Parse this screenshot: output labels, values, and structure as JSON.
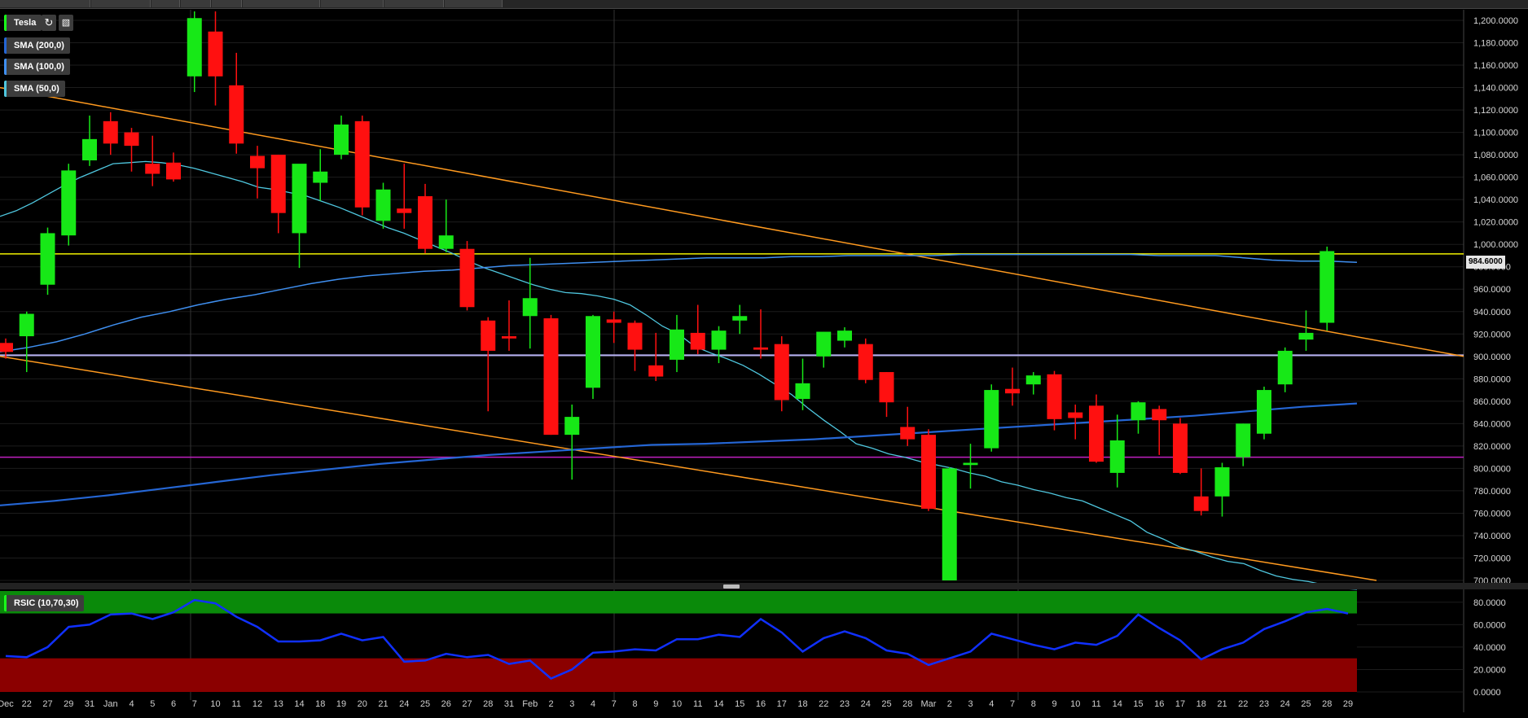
{
  "legend": {
    "symbol": "Tesla",
    "sma200": "SMA (200,0)",
    "sma100": "SMA (100,0)",
    "sma50": "SMA (50,0)",
    "rsi": "RSIC (10,70,30)"
  },
  "icons": {
    "refresh": "refresh-icon",
    "chart_type": "chart-type-icon"
  },
  "colors": {
    "up": "#17e817",
    "down": "#ff1010",
    "sma200": "#2566d4",
    "sma100": "#3f8ff0",
    "sma50": "#4fc7df",
    "trend": "#ff9a1f",
    "yellow": "#f0f000",
    "lavender": "#b9b3f5",
    "magenta": "#c020c0",
    "rsi_line": "#1030ff"
  },
  "last_price": "984.6000",
  "chart_data": [
    {
      "type": "candlestick",
      "title": "Tesla",
      "ylim": [
        700,
        1200
      ],
      "y_ticks": [
        "1,200.0000",
        "1,180.0000",
        "1,160.0000",
        "1,140.0000",
        "1,120.0000",
        "1,100.0000",
        "1,080.0000",
        "1,060.0000",
        "1,040.0000",
        "1,020.0000",
        "1,000.0000",
        "980.0000",
        "960.0000",
        "940.0000",
        "920.0000",
        "900.0000",
        "880.0000",
        "860.0000",
        "840.0000",
        "820.0000",
        "800.0000",
        "780.0000",
        "760.0000",
        "740.0000",
        "720.0000",
        "700.0000"
      ],
      "x_labels": [
        "Dec",
        "22",
        "27",
        "29",
        "31",
        "Jan",
        "4",
        "5",
        "6",
        "7",
        "10",
        "11",
        "12",
        "13",
        "14",
        "18",
        "19",
        "20",
        "21",
        "24",
        "25",
        "26",
        "27",
        "28",
        "31",
        "Feb",
        "2",
        "3",
        "4",
        "7",
        "8",
        "9",
        "10",
        "11",
        "14",
        "15",
        "16",
        "17",
        "18",
        "22",
        "23",
        "24",
        "25",
        "28",
        "Mar",
        "2",
        "3",
        "4",
        "7",
        "8",
        "9",
        "10",
        "11",
        "14",
        "15",
        "16",
        "17",
        "18",
        "21",
        "22",
        "23",
        "24",
        "25",
        "28",
        "29"
      ],
      "candles": [
        {
          "o": 912,
          "h": 916,
          "l": 898,
          "c": 904
        },
        {
          "o": 918,
          "h": 940,
          "l": 886,
          "c": 938
        },
        {
          "o": 964,
          "h": 1015,
          "l": 955,
          "c": 1010
        },
        {
          "o": 1008,
          "h": 1072,
          "l": 999,
          "c": 1066
        },
        {
          "o": 1075,
          "h": 1115,
          "l": 1070,
          "c": 1094
        },
        {
          "o": 1110,
          "h": 1118,
          "l": 1080,
          "c": 1090
        },
        {
          "o": 1100,
          "h": 1104,
          "l": 1065,
          "c": 1088
        },
        {
          "o": 1072,
          "h": 1097,
          "l": 1052,
          "c": 1063
        },
        {
          "o": 1073,
          "h": 1082,
          "l": 1056,
          "c": 1058
        },
        {
          "o": 1150,
          "h": 1208,
          "l": 1136,
          "c": 1202
        },
        {
          "o": 1190,
          "h": 1208,
          "l": 1124,
          "c": 1150
        },
        {
          "o": 1142,
          "h": 1171,
          "l": 1081,
          "c": 1090
        },
        {
          "o": 1079,
          "h": 1088,
          "l": 1041,
          "c": 1068
        },
        {
          "o": 1080,
          "h": 1080,
          "l": 1010,
          "c": 1028
        },
        {
          "o": 1010,
          "h": 1068,
          "l": 979,
          "c": 1072
        },
        {
          "o": 1055,
          "h": 1085,
          "l": 1039,
          "c": 1065
        },
        {
          "o": 1080,
          "h": 1115,
          "l": 1076,
          "c": 1107
        },
        {
          "o": 1110,
          "h": 1115,
          "l": 1026,
          "c": 1033
        },
        {
          "o": 1021,
          "h": 1055,
          "l": 1014,
          "c": 1049
        },
        {
          "o": 1032,
          "h": 1072,
          "l": 1014,
          "c": 1028
        },
        {
          "o": 1043,
          "h": 1054,
          "l": 992,
          "c": 996
        },
        {
          "o": 996,
          "h": 1040,
          "l": 993,
          "c": 1008
        },
        {
          "o": 996,
          "h": 1003,
          "l": 941,
          "c": 944
        },
        {
          "o": 932,
          "h": 935,
          "l": 851,
          "c": 905
        },
        {
          "o": 918,
          "h": 950,
          "l": 905,
          "c": 916
        },
        {
          "o": 936,
          "h": 988,
          "l": 907,
          "c": 952
        },
        {
          "o": 934,
          "h": 937,
          "l": 830,
          "c": 830
        },
        {
          "o": 830,
          "h": 857,
          "l": 790,
          "c": 846
        },
        {
          "o": 872,
          "h": 937,
          "l": 862,
          "c": 936
        },
        {
          "o": 933,
          "h": 940,
          "l": 912,
          "c": 930
        },
        {
          "o": 930,
          "h": 932,
          "l": 887,
          "c": 906
        },
        {
          "o": 892,
          "h": 921,
          "l": 878,
          "c": 882
        },
        {
          "o": 897,
          "h": 937,
          "l": 886,
          "c": 924
        },
        {
          "o": 921,
          "h": 946,
          "l": 902,
          "c": 906
        },
        {
          "o": 906,
          "h": 927,
          "l": 894,
          "c": 923
        },
        {
          "o": 932,
          "h": 946,
          "l": 920,
          "c": 936
        },
        {
          "o": 908,
          "h": 942,
          "l": 898,
          "c": 906
        },
        {
          "o": 911,
          "h": 918,
          "l": 851,
          "c": 861
        },
        {
          "o": 862,
          "h": 898,
          "l": 852,
          "c": 876
        },
        {
          "o": 900,
          "h": 922,
          "l": 890,
          "c": 922
        },
        {
          "o": 914,
          "h": 926,
          "l": 908,
          "c": 923
        },
        {
          "o": 911,
          "h": 916,
          "l": 876,
          "c": 879
        },
        {
          "o": 886,
          "h": 886,
          "l": 846,
          "c": 859
        },
        {
          "o": 837,
          "h": 855,
          "l": 820,
          "c": 826
        },
        {
          "o": 830,
          "h": 835,
          "l": 762,
          "c": 764
        },
        {
          "o": 700,
          "h": 801,
          "l": 700,
          "c": 800
        },
        {
          "o": 803,
          "h": 822,
          "l": 782,
          "c": 805
        },
        {
          "o": 818,
          "h": 875,
          "l": 815,
          "c": 870
        },
        {
          "o": 871,
          "h": 890,
          "l": 856,
          "c": 867
        },
        {
          "o": 875,
          "h": 886,
          "l": 866,
          "c": 883
        },
        {
          "o": 884,
          "h": 887,
          "l": 834,
          "c": 844
        },
        {
          "o": 850,
          "h": 857,
          "l": 826,
          "c": 845
        },
        {
          "o": 856,
          "h": 866,
          "l": 805,
          "c": 806
        },
        {
          "o": 796,
          "h": 848,
          "l": 783,
          "c": 825
        },
        {
          "o": 843,
          "h": 860,
          "l": 831,
          "c": 859
        },
        {
          "o": 853,
          "h": 856,
          "l": 812,
          "c": 843
        },
        {
          "o": 840,
          "h": 845,
          "l": 795,
          "c": 796
        },
        {
          "o": 775,
          "h": 800,
          "l": 758,
          "c": 762
        },
        {
          "o": 775,
          "h": 805,
          "l": 757,
          "c": 801
        },
        {
          "o": 810,
          "h": 840,
          "l": 802,
          "c": 840
        },
        {
          "o": 831,
          "h": 873,
          "l": 826,
          "c": 870
        },
        {
          "o": 875,
          "h": 908,
          "l": 868,
          "c": 905
        },
        {
          "o": 915,
          "h": 941,
          "l": 905,
          "c": 921
        },
        {
          "o": 930,
          "h": 998,
          "l": 923,
          "c": 994
        }
      ],
      "sma50": [
        1025,
        1030,
        1037,
        1045,
        1053,
        1060,
        1066,
        1072,
        1073,
        1074,
        1073,
        1071,
        1068,
        1064,
        1060,
        1056,
        1051,
        1049,
        1046,
        1043,
        1038,
        1033,
        1027,
        1021,
        1015,
        1010,
        1004,
        998,
        992,
        985,
        979,
        974,
        969,
        964,
        960,
        957,
        956,
        954,
        951,
        946,
        937,
        927,
        920,
        909,
        903,
        898,
        892,
        884,
        875,
        866,
        854,
        843,
        833,
        822,
        818,
        813,
        810,
        806,
        803,
        800,
        796,
        793,
        788,
        785,
        781,
        778,
        774,
        771,
        765,
        759,
        753,
        743,
        737,
        730,
        726,
        721,
        717,
        715,
        709,
        704,
        701,
        699,
        696,
        693,
        692
      ],
      "sma100": [
        904,
        908,
        913,
        920,
        928,
        935,
        940,
        946,
        951,
        955,
        960,
        965,
        969,
        972,
        974,
        976,
        977,
        979,
        981,
        982,
        983,
        984,
        985,
        986,
        987,
        988,
        988,
        988,
        989,
        989,
        990,
        990,
        990,
        990,
        991,
        991,
        991,
        991,
        991,
        991,
        991,
        990,
        990,
        990,
        988,
        986,
        985,
        985,
        984
      ],
      "sma200": [
        767,
        771,
        776,
        782,
        788,
        794,
        799,
        804,
        808,
        812,
        815,
        818,
        821,
        822,
        824,
        826,
        829,
        832,
        835,
        838,
        841,
        844,
        847,
        851,
        855,
        858
      ],
      "trend_upper": [
        1140,
        900
      ],
      "trend_lower": [
        900,
        700
      ],
      "hlines": [
        991.5,
        901,
        810
      ]
    },
    {
      "type": "line",
      "title": "RSIC (10,70,30)",
      "ylim": [
        0,
        90
      ],
      "y_ticks": [
        "80.0000",
        "60.0000",
        "40.0000",
        "20.0000",
        "0.0000"
      ],
      "overbought": 70,
      "oversold": 30,
      "values": [
        32,
        31,
        40,
        58,
        60,
        69,
        70,
        65,
        71,
        82,
        79,
        67,
        58,
        45,
        45,
        46,
        52,
        46,
        49,
        27,
        28,
        34,
        31,
        33,
        25,
        28,
        12,
        20,
        35,
        36,
        38,
        37,
        47,
        47,
        51,
        49,
        65,
        53,
        36,
        48,
        54,
        48,
        37,
        34,
        24,
        30,
        36,
        52,
        47,
        42,
        38,
        44,
        42,
        50,
        69,
        57,
        46,
        29,
        38,
        44,
        56,
        63,
        71,
        74,
        70
      ]
    }
  ]
}
